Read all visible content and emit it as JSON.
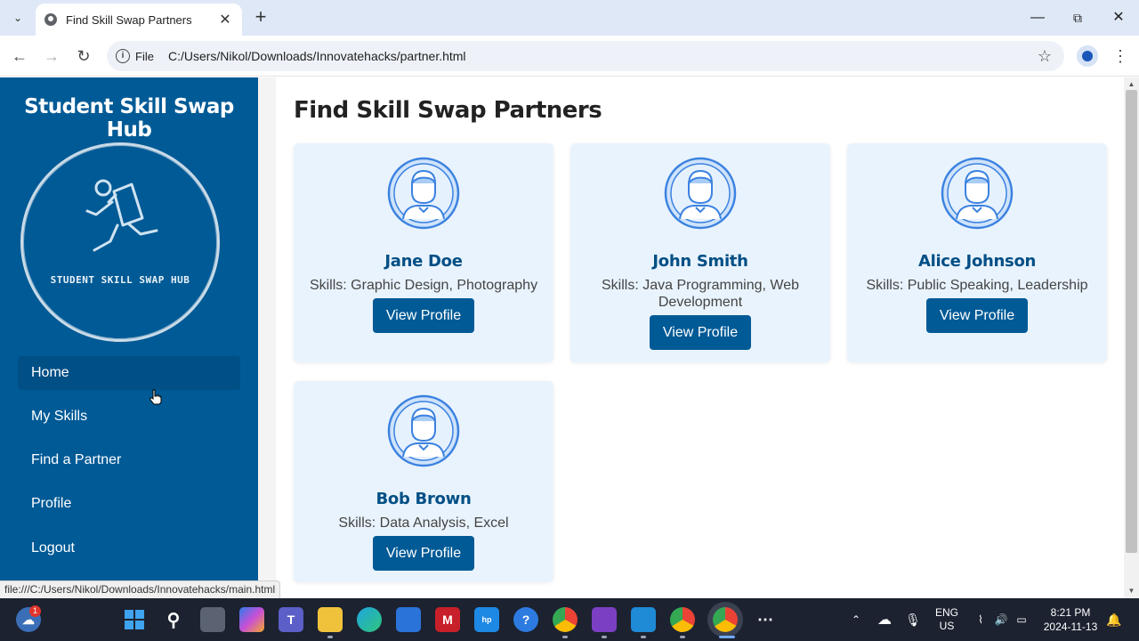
{
  "browser": {
    "tab_title": "Find Skill Swap Partners",
    "url_chip": "File",
    "url": "C:/Users/Nikol/Downloads/Innovatehacks/partner.html",
    "status_url": "file:///C:/Users/Nikol/Downloads/Innovatehacks/main.html"
  },
  "sidebar": {
    "brand": "Student Skill Swap Hub",
    "logo_text": "STUDENT SKILL SWAP HUB",
    "items": [
      {
        "label": "Home"
      },
      {
        "label": "My Skills"
      },
      {
        "label": "Find a Partner"
      },
      {
        "label": "Profile"
      },
      {
        "label": "Logout"
      }
    ]
  },
  "main": {
    "title": "Find Skill Swap Partners",
    "button_label": "View Profile",
    "partners": [
      {
        "name": "Jane Doe",
        "skills": "Skills: Graphic Design, Photography"
      },
      {
        "name": "John Smith",
        "skills": "Skills: Java Programming, Web Development"
      },
      {
        "name": "Alice Johnson",
        "skills": "Skills: Public Speaking, Leadership"
      },
      {
        "name": "Bob Brown",
        "skills": "Skills: Data Analysis, Excel"
      }
    ]
  },
  "taskbar": {
    "weather_badge": "1",
    "language": "ENG",
    "region": "US",
    "time": "8:21 PM",
    "date": "2024-11-13"
  },
  "colors": {
    "sidebar": "#005a96",
    "card": "#e9f3fd",
    "accent": "#004f85"
  }
}
